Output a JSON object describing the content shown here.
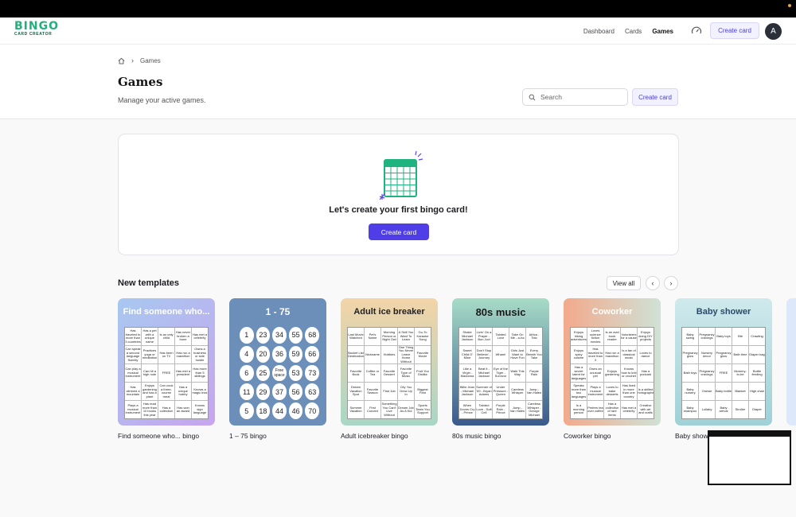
{
  "app": {
    "logo_main": "BINGO",
    "logo_sub": "CARD CREATOR"
  },
  "nav": {
    "items": [
      {
        "label": "Dashboard",
        "active": false
      },
      {
        "label": "Cards",
        "active": false
      },
      {
        "label": "Games",
        "active": true
      }
    ],
    "create_label": "Create card",
    "avatar_initial": "A"
  },
  "header": {
    "breadcrumb": "Games",
    "title": "Games",
    "subtitle": "Manage your active games.",
    "search_placeholder": "Search",
    "create_label": "Create card"
  },
  "empty_state": {
    "message": "Let's create your first bingo card!",
    "button_label": "Create card"
  },
  "templates_section": {
    "title": "New templates",
    "view_all_label": "View all"
  },
  "templates": [
    {
      "label": "Find someone who... bingo",
      "heading": "Find someone who...",
      "cells": [
        "Has traveled to more than 3 countries",
        "Has a pet with a unique name",
        "Is an only child",
        "Has never broken a bone",
        "Has met a celebrity",
        "Can speak a second language fluently",
        "Practices yoga or meditation",
        "Has been on TV",
        "Has run a marathon",
        "Owns a business or side hustle",
        "Can play a musical instrument",
        "Can hit a high note",
        "FREE",
        "Has met a president",
        "Has more than 5 siblings",
        "Has climbed a mountain",
        "Enjoys gardening and has a plant",
        "Can cook a three-course meal",
        "Has a unique hobby",
        "Knows a magic trick",
        "Plays a musical instrument",
        "Has read more than 10 books this year",
        "Has a collection",
        "Has won an award",
        "Knows sign language"
      ]
    },
    {
      "label": "1 – 75 bingo",
      "heading": "1 - 75",
      "numbers": [
        "1",
        "23",
        "34",
        "55",
        "68",
        "4",
        "20",
        "36",
        "59",
        "66",
        "6",
        "25",
        "Free space",
        "53",
        "73",
        "11",
        "29",
        "37",
        "56",
        "63",
        "5",
        "18",
        "44",
        "46",
        "70"
      ]
    },
    {
      "label": "Adult icebreaker bingo",
      "heading": "Adult ice breaker",
      "cells": [
        "Last Movie Watched",
        "Pet's Name",
        "Morning Person or Night Owl",
        "A Skill You Want To Learn",
        "Go-To Karaoke Song",
        "Bucket List Destination",
        "Nickname",
        "Hobbies",
        "One Thing You Never Leave Home Without",
        "Favorite Movie",
        "Favorite Book",
        "Coffee or Tea",
        "Favorite Dessert",
        "Favorite Type of Music",
        "Fruit You Dislike",
        "Dream Vacation Spot",
        "Favorite Season",
        "First Job",
        "City You Grew Up In",
        "Biggest Fear",
        "Summer Vacation",
        "First Concert",
        "Something You Can't Live Without",
        "Dream Job As A Kid",
        "Sports Team You Support"
      ]
    },
    {
      "label": "80s music bingo",
      "heading": "80s music",
      "cells": [
        "Shake Michael Jackson",
        "Livin' On a Prayer - Bon Jovi",
        "Tainted Love",
        "Take On Me - a-ha",
        "Africa - Toto",
        "Sweet Child O' Mine",
        "Don't Stop Believin' - Journey",
        "Wham!",
        "Girls Just Want to Have Fun",
        "Every Breath You Take",
        "Like a Virgin - Madonna",
        "Beat It - Michael Jackson",
        "Eye of the Tiger - Survivor",
        "Walk This Way",
        "Purple Rain",
        "Billie Jean - Michael Jackson",
        "Summer of '69 - Bryan Adams",
        "Under Pressure - Queen",
        "Careless Whisper",
        "Jump - Van Halen",
        "When Doves Cry - Prince",
        "Tainted Love - Soft Cell",
        "Purple Rain - Prince",
        "Jump - Van Halen",
        "Careless Whisper - George Michael"
      ]
    },
    {
      "label": "Coworker bingo",
      "heading": "Coworker",
      "cells": [
        "Enjoys hiking adventures",
        "Loves science fiction movies",
        "Is an avid book reader",
        "Volunteers for a cause",
        "Enjoys doing DIY projects",
        "Enjoys spicy cuisine",
        "Has traveled to more than 3",
        "Has run a marathon",
        "Is a fan of classical music",
        "Loves to dance",
        "Has a secret talent for languages",
        "Owns an unusual pet",
        "Enjoys gardening",
        "Knows how to knit or crochet",
        "Has a podcast",
        "Speaks more than two languages",
        "Plays a musical instrument",
        "Loves to bake desserts",
        "Has lived in more than one country",
        "Is a skilled photographer",
        "Is a morning person",
        "Prefers tea over coffee",
        "Has a collection of rare items",
        "Has met a celebrity",
        "Creative with art and crafts"
      ]
    },
    {
      "label": "Baby shower bingo",
      "heading": "Baby shower",
      "cells": [
        "Baby swing",
        "Pregnancy cravings",
        "Baby toys",
        "Bib",
        "Crawling",
        "Pregnancy glow",
        "Nursery decor",
        "Pregnancy glow",
        "Bath time",
        "Diaper bag",
        "Bath toys",
        "Pregnancy cravings",
        "FREE",
        "Mommy-to-be",
        "Bottle feeding",
        "Baby nursery",
        "Onesie",
        "Baby bottle",
        "Blanket",
        "High chair",
        "Baby shampoo",
        "Lullaby",
        "Baby arrival",
        "Stroller",
        "Diaper"
      ]
    }
  ]
}
